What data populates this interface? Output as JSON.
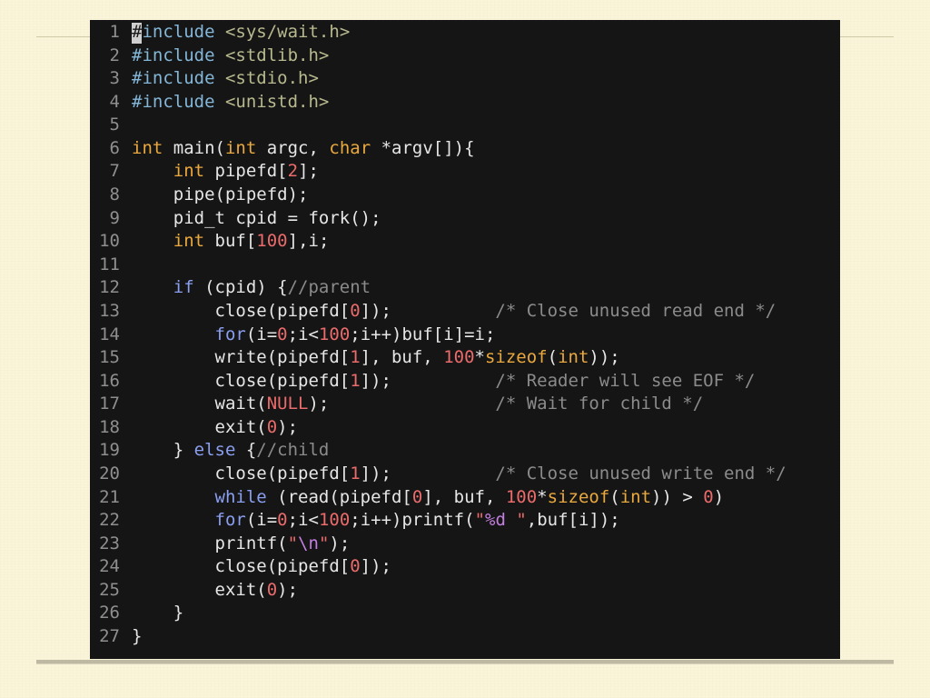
{
  "slide": {
    "colors": {
      "background": "#faf5da",
      "rule": "#d0caa8",
      "rule_bottom": "#bdb9a2"
    }
  },
  "editor": {
    "colors": {
      "background": "#151515",
      "line_number": "#8f8f8f",
      "cursor": "#cfcfcf"
    },
    "lines": [
      {
        "number": "1",
        "tokens": [
          [
            "#",
            "#1a1a1a"
          ],
          [
            "include",
            "#84b6d8"
          ],
          [
            " ",
            "#e6e6e6"
          ],
          [
            "<sys/wait.h>",
            "#b8b98e"
          ]
        ]
      },
      {
        "number": "2",
        "tokens": [
          [
            "#include",
            "#84b6d8"
          ],
          [
            " ",
            "#e6e6e6"
          ],
          [
            "<stdlib.h>",
            "#b8b98e"
          ]
        ]
      },
      {
        "number": "3",
        "tokens": [
          [
            "#include",
            "#84b6d8"
          ],
          [
            " ",
            "#e6e6e6"
          ],
          [
            "<stdio.h>",
            "#b8b98e"
          ]
        ]
      },
      {
        "number": "4",
        "tokens": [
          [
            "#include",
            "#84b6d8"
          ],
          [
            " ",
            "#e6e6e6"
          ],
          [
            "<unistd.h>",
            "#b8b98e"
          ]
        ]
      },
      {
        "number": "5",
        "tokens": []
      },
      {
        "number": "6",
        "tokens": [
          [
            "int",
            "#eaa93e"
          ],
          [
            " main(",
            "#e6e6e6"
          ],
          [
            "int",
            "#eaa93e"
          ],
          [
            " argc, ",
            "#e6e6e6"
          ],
          [
            "char",
            "#eaa93e"
          ],
          [
            " *argv[]){",
            "#e6e6e6"
          ]
        ]
      },
      {
        "number": "7",
        "tokens": [
          [
            "    ",
            "#e6e6e6"
          ],
          [
            "int",
            "#eaa93e"
          ],
          [
            " pipefd[",
            "#e6e6e6"
          ],
          [
            "2",
            "#ea6b6b"
          ],
          [
            "];",
            "#e6e6e6"
          ]
        ]
      },
      {
        "number": "8",
        "tokens": [
          [
            "    pipe(pipefd);",
            "#e6e6e6"
          ]
        ]
      },
      {
        "number": "9",
        "tokens": [
          [
            "    pid_t cpid = fork();",
            "#e6e6e6"
          ]
        ]
      },
      {
        "number": "10",
        "tokens": [
          [
            "    ",
            "#e6e6e6"
          ],
          [
            "int",
            "#eaa93e"
          ],
          [
            " buf[",
            "#e6e6e6"
          ],
          [
            "100",
            "#ea6b6b"
          ],
          [
            "],i;",
            "#e6e6e6"
          ]
        ]
      },
      {
        "number": "11",
        "tokens": []
      },
      {
        "number": "12",
        "tokens": [
          [
            "    ",
            "#e6e6e6"
          ],
          [
            "if",
            "#8b9ff0"
          ],
          [
            " (cpid) {",
            "#e6e6e6"
          ],
          [
            "//parent",
            "#8b8b8b"
          ]
        ]
      },
      {
        "number": "13",
        "tokens": [
          [
            "        close(pipefd[",
            "#e6e6e6"
          ],
          [
            "0",
            "#ea6b6b"
          ],
          [
            "]);          ",
            "#e6e6e6"
          ],
          [
            "/* Close unused read end */",
            "#8b8b8b"
          ]
        ]
      },
      {
        "number": "14",
        "tokens": [
          [
            "        ",
            "#e6e6e6"
          ],
          [
            "for",
            "#8b9ff0"
          ],
          [
            "(i=",
            "#e6e6e6"
          ],
          [
            "0",
            "#ea6b6b"
          ],
          [
            ";i<",
            "#e6e6e6"
          ],
          [
            "100",
            "#ea6b6b"
          ],
          [
            ";i++)buf[i]=i;",
            "#e6e6e6"
          ]
        ]
      },
      {
        "number": "15",
        "tokens": [
          [
            "        write(pipefd[",
            "#e6e6e6"
          ],
          [
            "1",
            "#ea6b6b"
          ],
          [
            "], buf, ",
            "#e6e6e6"
          ],
          [
            "100",
            "#ea6b6b"
          ],
          [
            "*",
            "#e6e6e6"
          ],
          [
            "sizeof",
            "#eaa93e"
          ],
          [
            "(",
            "#e6e6e6"
          ],
          [
            "int",
            "#eaa93e"
          ],
          [
            "));",
            "#e6e6e6"
          ]
        ]
      },
      {
        "number": "16",
        "tokens": [
          [
            "        close(pipefd[",
            "#e6e6e6"
          ],
          [
            "1",
            "#ea6b6b"
          ],
          [
            "]);          ",
            "#e6e6e6"
          ],
          [
            "/* Reader will see EOF */",
            "#8b8b8b"
          ]
        ]
      },
      {
        "number": "17",
        "tokens": [
          [
            "        wait(",
            "#e6e6e6"
          ],
          [
            "NULL",
            "#ea6b6b"
          ],
          [
            ");                ",
            "#e6e6e6"
          ],
          [
            "/* Wait for child */",
            "#8b8b8b"
          ]
        ]
      },
      {
        "number": "18",
        "tokens": [
          [
            "        exit(",
            "#e6e6e6"
          ],
          [
            "0",
            "#ea6b6b"
          ],
          [
            ");",
            "#e6e6e6"
          ]
        ]
      },
      {
        "number": "19",
        "tokens": [
          [
            "    } ",
            "#e6e6e6"
          ],
          [
            "else",
            "#8b9ff0"
          ],
          [
            " {",
            "#e6e6e6"
          ],
          [
            "//child",
            "#8b8b8b"
          ]
        ]
      },
      {
        "number": "20",
        "tokens": [
          [
            "        close(pipefd[",
            "#e6e6e6"
          ],
          [
            "1",
            "#ea6b6b"
          ],
          [
            "]);          ",
            "#e6e6e6"
          ],
          [
            "/* Close unused write end */",
            "#8b8b8b"
          ]
        ]
      },
      {
        "number": "21",
        "tokens": [
          [
            "        ",
            "#e6e6e6"
          ],
          [
            "while",
            "#8b9ff0"
          ],
          [
            " (read(pipefd[",
            "#e6e6e6"
          ],
          [
            "0",
            "#ea6b6b"
          ],
          [
            "], buf, ",
            "#e6e6e6"
          ],
          [
            "100",
            "#ea6b6b"
          ],
          [
            "*",
            "#e6e6e6"
          ],
          [
            "sizeof",
            "#eaa93e"
          ],
          [
            "(",
            "#e6e6e6"
          ],
          [
            "int",
            "#eaa93e"
          ],
          [
            ")) > ",
            "#e6e6e6"
          ],
          [
            "0",
            "#ea6b6b"
          ],
          [
            ")",
            "#e6e6e6"
          ]
        ]
      },
      {
        "number": "22",
        "tokens": [
          [
            "        ",
            "#e6e6e6"
          ],
          [
            "for",
            "#8b9ff0"
          ],
          [
            "(i=",
            "#e6e6e6"
          ],
          [
            "0",
            "#ea6b6b"
          ],
          [
            ";i<",
            "#e6e6e6"
          ],
          [
            "100",
            "#ea6b6b"
          ],
          [
            ";i++)printf(",
            "#e6e6e6"
          ],
          [
            "\"",
            "#ea6b6b"
          ],
          [
            "%d",
            "#c47fe0"
          ],
          [
            " \"",
            "#ea6b6b"
          ],
          [
            ",buf[i]);",
            "#e6e6e6"
          ]
        ]
      },
      {
        "number": "23",
        "tokens": [
          [
            "        printf(",
            "#e6e6e6"
          ],
          [
            "\"",
            "#ea6b6b"
          ],
          [
            "\\n",
            "#c47fe0"
          ],
          [
            "\"",
            "#ea6b6b"
          ],
          [
            ");",
            "#e6e6e6"
          ]
        ]
      },
      {
        "number": "24",
        "tokens": [
          [
            "        close(pipefd[",
            "#e6e6e6"
          ],
          [
            "0",
            "#ea6b6b"
          ],
          [
            "]);",
            "#e6e6e6"
          ]
        ]
      },
      {
        "number": "25",
        "tokens": [
          [
            "        exit(",
            "#e6e6e6"
          ],
          [
            "0",
            "#ea6b6b"
          ],
          [
            ");",
            "#e6e6e6"
          ]
        ]
      },
      {
        "number": "26",
        "tokens": [
          [
            "    }",
            "#e6e6e6"
          ]
        ]
      },
      {
        "number": "27",
        "tokens": [
          [
            "}",
            "#e6e6e6"
          ]
        ]
      }
    ]
  }
}
